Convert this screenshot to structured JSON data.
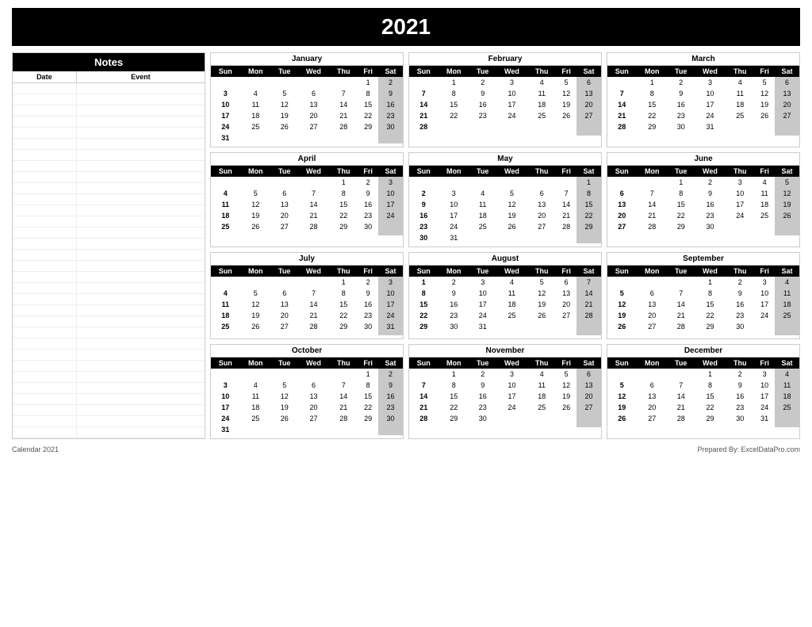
{
  "year": "2021",
  "footer": {
    "left": "Calendar 2021",
    "right": "Prepared By: ExcelDataPro.com"
  },
  "notes": {
    "title": "Notes",
    "col1": "Date",
    "col2": "Event",
    "lines": 32
  },
  "months": [
    {
      "name": "January",
      "startDay": 5,
      "days": 31,
      "weeks": [
        [
          "",
          "",
          "",
          "",
          "",
          "1",
          "2"
        ],
        [
          "3",
          "4",
          "5",
          "6",
          "7",
          "8",
          "9"
        ],
        [
          "10",
          "11",
          "12",
          "13",
          "14",
          "15",
          "16"
        ],
        [
          "17",
          "18",
          "19",
          "20",
          "21",
          "22",
          "23"
        ],
        [
          "24",
          "25",
          "26",
          "27",
          "28",
          "29",
          "30"
        ],
        [
          "31",
          "",
          "",
          "",
          "",
          "",
          ""
        ]
      ]
    },
    {
      "name": "February",
      "startDay": 1,
      "days": 28,
      "weeks": [
        [
          "",
          "1",
          "2",
          "3",
          "4",
          "5",
          "6"
        ],
        [
          "7",
          "8",
          "9",
          "10",
          "11",
          "12",
          "13"
        ],
        [
          "14",
          "15",
          "16",
          "17",
          "18",
          "19",
          "20"
        ],
        [
          "21",
          "22",
          "23",
          "24",
          "25",
          "26",
          "27"
        ],
        [
          "28",
          "",
          "",
          "",
          "",
          "",
          ""
        ],
        [
          "",
          "",
          "",
          "",
          "",
          "",
          ""
        ]
      ]
    },
    {
      "name": "March",
      "startDay": 1,
      "days": 31,
      "weeks": [
        [
          "",
          "1",
          "2",
          "3",
          "4",
          "5",
          "6"
        ],
        [
          "7",
          "8",
          "9",
          "10",
          "11",
          "12",
          "13"
        ],
        [
          "14",
          "15",
          "16",
          "17",
          "18",
          "19",
          "20"
        ],
        [
          "21",
          "22",
          "23",
          "24",
          "25",
          "26",
          "27"
        ],
        [
          "28",
          "29",
          "30",
          "31",
          "",
          "",
          ""
        ],
        [
          "",
          "",
          "",
          "",
          "",
          "",
          ""
        ]
      ]
    },
    {
      "name": "April",
      "startDay": 4,
      "days": 30,
      "weeks": [
        [
          "",
          "",
          "",
          "",
          "1",
          "2",
          "3"
        ],
        [
          "4",
          "5",
          "6",
          "7",
          "8",
          "9",
          "10"
        ],
        [
          "11",
          "12",
          "13",
          "14",
          "15",
          "16",
          "17"
        ],
        [
          "18",
          "19",
          "20",
          "21",
          "22",
          "23",
          "24"
        ],
        [
          "25",
          "26",
          "27",
          "28",
          "29",
          "30",
          ""
        ],
        [
          "",
          "",
          "",
          "",
          "",
          "",
          ""
        ]
      ]
    },
    {
      "name": "May",
      "startDay": 6,
      "days": 31,
      "weeks": [
        [
          "",
          "",
          "",
          "",
          "",
          "",
          "1"
        ],
        [
          "2",
          "3",
          "4",
          "5",
          "6",
          "7",
          "8"
        ],
        [
          "9",
          "10",
          "11",
          "12",
          "13",
          "14",
          "15"
        ],
        [
          "16",
          "17",
          "18",
          "19",
          "20",
          "21",
          "22"
        ],
        [
          "23",
          "24",
          "25",
          "26",
          "27",
          "28",
          "29"
        ],
        [
          "30",
          "31",
          "",
          "",
          "",
          "",
          ""
        ]
      ]
    },
    {
      "name": "June",
      "startDay": 2,
      "days": 30,
      "weeks": [
        [
          "",
          "",
          "1",
          "2",
          "3",
          "4",
          "5"
        ],
        [
          "6",
          "7",
          "8",
          "9",
          "10",
          "11",
          "12"
        ],
        [
          "13",
          "14",
          "15",
          "16",
          "17",
          "18",
          "19"
        ],
        [
          "20",
          "21",
          "22",
          "23",
          "24",
          "25",
          "26"
        ],
        [
          "27",
          "28",
          "29",
          "30",
          "",
          "",
          ""
        ],
        [
          "",
          "",
          "",
          "",
          "",
          "",
          ""
        ]
      ]
    },
    {
      "name": "July",
      "startDay": 4,
      "days": 31,
      "weeks": [
        [
          "",
          "",
          "",
          "",
          "1",
          "2",
          "3"
        ],
        [
          "4",
          "5",
          "6",
          "7",
          "8",
          "9",
          "10"
        ],
        [
          "11",
          "12",
          "13",
          "14",
          "15",
          "16",
          "17"
        ],
        [
          "18",
          "19",
          "20",
          "21",
          "22",
          "23",
          "24"
        ],
        [
          "25",
          "26",
          "27",
          "28",
          "29",
          "30",
          "31"
        ],
        [
          "",
          "",
          "",
          "",
          "",
          "",
          ""
        ]
      ]
    },
    {
      "name": "August",
      "startDay": 0,
      "days": 31,
      "weeks": [
        [
          "1",
          "2",
          "3",
          "4",
          "5",
          "6",
          "7"
        ],
        [
          "8",
          "9",
          "10",
          "11",
          "12",
          "13",
          "14"
        ],
        [
          "15",
          "16",
          "17",
          "18",
          "19",
          "20",
          "21"
        ],
        [
          "22",
          "23",
          "24",
          "25",
          "26",
          "27",
          "28"
        ],
        [
          "29",
          "30",
          "31",
          "",
          "",
          "",
          ""
        ],
        [
          "",
          "",
          "",
          "",
          "",
          "",
          ""
        ]
      ]
    },
    {
      "name": "September",
      "startDay": 3,
      "days": 30,
      "weeks": [
        [
          "",
          "",
          "",
          "1",
          "2",
          "3",
          "4"
        ],
        [
          "5",
          "6",
          "7",
          "8",
          "9",
          "10",
          "11"
        ],
        [
          "12",
          "13",
          "14",
          "15",
          "16",
          "17",
          "18"
        ],
        [
          "19",
          "20",
          "21",
          "22",
          "23",
          "24",
          "25"
        ],
        [
          "26",
          "27",
          "28",
          "29",
          "30",
          "",
          ""
        ],
        [
          "",
          "",
          "",
          "",
          "",
          "",
          ""
        ]
      ]
    },
    {
      "name": "October",
      "startDay": 5,
      "days": 31,
      "weeks": [
        [
          "",
          "",
          "",
          "",
          "",
          "1",
          "2"
        ],
        [
          "3",
          "4",
          "5",
          "6",
          "7",
          "8",
          "9"
        ],
        [
          "10",
          "11",
          "12",
          "13",
          "14",
          "15",
          "16"
        ],
        [
          "17",
          "18",
          "19",
          "20",
          "21",
          "22",
          "23"
        ],
        [
          "24",
          "25",
          "26",
          "27",
          "28",
          "29",
          "30"
        ],
        [
          "31",
          "",
          "",
          "",
          "",
          "",
          ""
        ]
      ]
    },
    {
      "name": "November",
      "startDay": 1,
      "days": 30,
      "weeks": [
        [
          "",
          "1",
          "2",
          "3",
          "4",
          "5",
          "6"
        ],
        [
          "7",
          "8",
          "9",
          "10",
          "11",
          "12",
          "13"
        ],
        [
          "14",
          "15",
          "16",
          "17",
          "18",
          "19",
          "20"
        ],
        [
          "21",
          "22",
          "23",
          "24",
          "25",
          "26",
          "27"
        ],
        [
          "28",
          "29",
          "30",
          "",
          "",
          "",
          ""
        ],
        [
          "",
          "",
          "",
          "",
          "",
          "",
          ""
        ]
      ]
    },
    {
      "name": "December",
      "startDay": 3,
      "days": 31,
      "weeks": [
        [
          "",
          "",
          "",
          "1",
          "2",
          "3",
          "4"
        ],
        [
          "5",
          "6",
          "7",
          "8",
          "9",
          "10",
          "11"
        ],
        [
          "12",
          "13",
          "14",
          "15",
          "16",
          "17",
          "18"
        ],
        [
          "19",
          "20",
          "21",
          "22",
          "23",
          "24",
          "25"
        ],
        [
          "26",
          "27",
          "28",
          "29",
          "30",
          "31",
          ""
        ],
        [
          "",
          "",
          "",
          "",
          "",
          "",
          ""
        ]
      ]
    }
  ],
  "dayHeaders": [
    "Sun",
    "Mon",
    "Tue",
    "Wed",
    "Thu",
    "Fri",
    "Sat"
  ]
}
